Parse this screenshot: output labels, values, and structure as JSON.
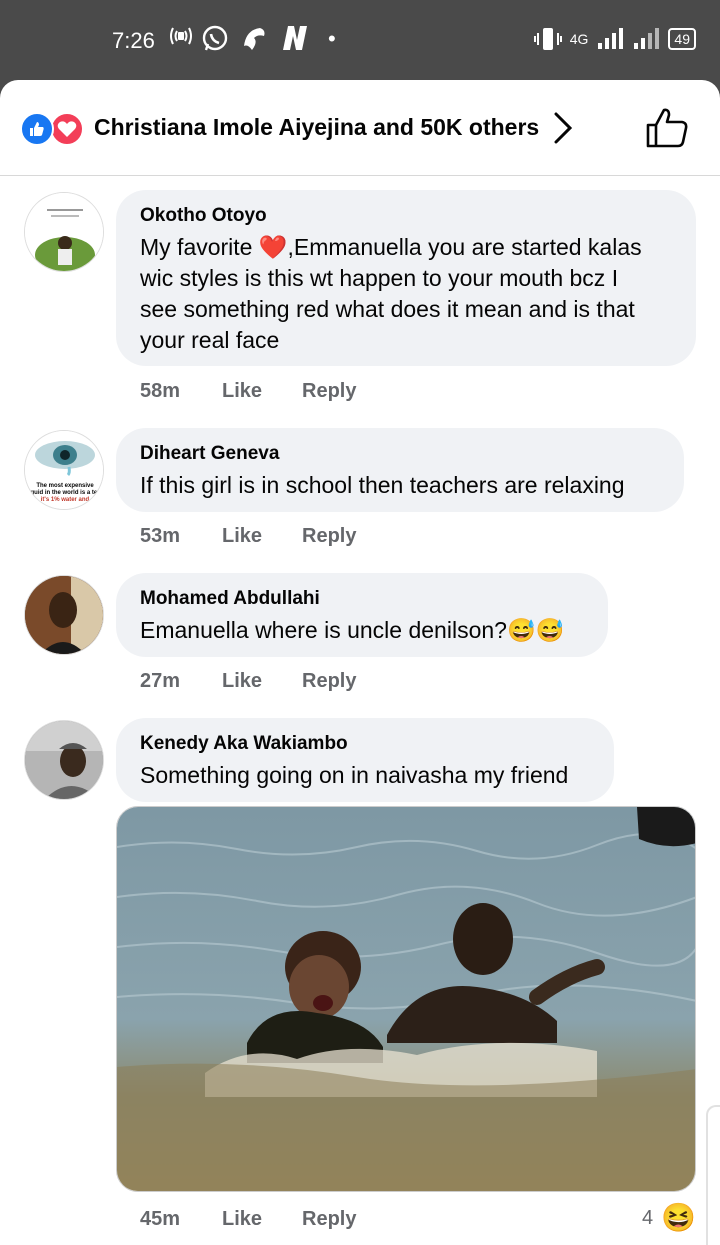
{
  "status_bar": {
    "time": "7:26",
    "network": "4G",
    "battery": "49"
  },
  "reactions": {
    "summary": "Christiana Imole Aiyejina and 50K others"
  },
  "comments": [
    {
      "author": "Okotho Otoyo",
      "text_lines": [
        "My favorite ❤️,Emmanuella you are started kalas",
        "wic styles is this wt happen to your mouth bcz I",
        "see something red what does it mean and is that",
        "your real face"
      ],
      "time": "58m",
      "like": "Like",
      "reply": "Reply"
    },
    {
      "author": "Diheart Geneva",
      "text_lines": [
        "If this girl is in school then teachers are relaxing"
      ],
      "time": "53m",
      "like": "Like",
      "reply": "Reply"
    },
    {
      "author": "Mohamed Abdullahi",
      "text_lines": [
        "Emanuella where is uncle denilson?😅😅"
      ],
      "time": "27m",
      "like": "Like",
      "reply": "Reply"
    },
    {
      "author": "Kenedy Aka Wakiambo",
      "text_lines": [
        "Something going on in naivasha my friend"
      ],
      "time": "45m",
      "like": "Like",
      "reply": "Reply",
      "reaction_count": "4",
      "reaction_emoji": "😆"
    }
  ],
  "avatar_texts": {
    "diheart": [
      "The most expensive",
      "liquid in the world is a tear",
      "it's 1% water and"
    ]
  },
  "colors": {
    "facebook_blue": "#1877f2",
    "love_red": "#f33e58",
    "bubble_bg": "#f0f2f5",
    "meta_gray": "#65676b"
  },
  "icons": [
    "like-reaction-icon",
    "love-reaction-icon",
    "chevron-right-icon",
    "thumbs-up-icon",
    "laughing-emoji-icon"
  ]
}
